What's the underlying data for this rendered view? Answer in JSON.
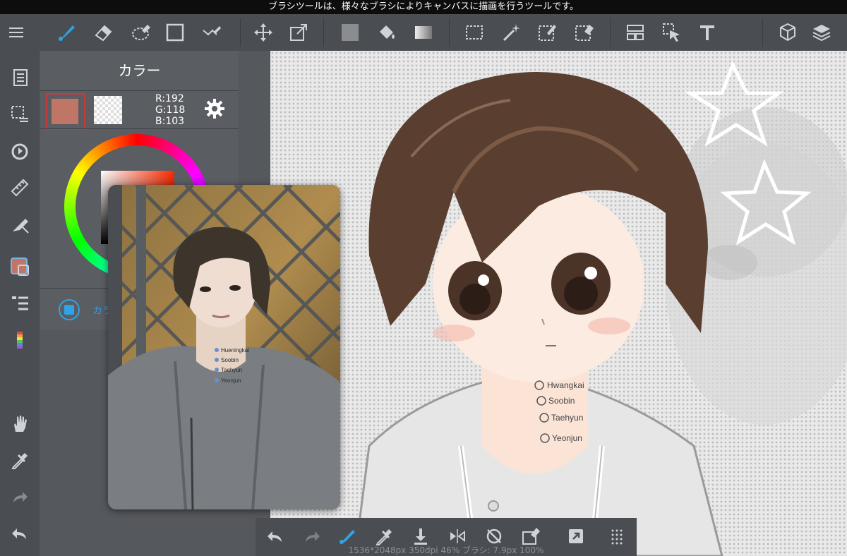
{
  "status_bar": {
    "hint": "ブラシツールは、様々なブラシによりキャンバスに描画を行うツールです。"
  },
  "toolbar": {
    "icons": [
      "menu-icon",
      "brush-icon",
      "eraser-icon",
      "blur-icon",
      "rectangle-icon",
      "select-icon",
      "move-icon",
      "transform-icon",
      "fill-color-icon",
      "bucket-icon",
      "gradient-icon",
      "select-rect-icon",
      "magic-wand-icon",
      "select-pen-icon",
      "select-eraser-icon",
      "frame-icon",
      "operation-icon",
      "text-icon",
      "3d-icon",
      "layers-icon"
    ]
  },
  "color_panel": {
    "title": "カラー",
    "r": "R:192",
    "g": "G:118",
    "b": "B:103",
    "primary_color": "#c07667",
    "secondary_color": "transparent",
    "mode_label": "カラ"
  },
  "bottom_bar": {
    "status_text": "1536*2048px 350dpi 46% ブラシ: 7.9px 100%"
  },
  "artwork": {
    "names": [
      "Hwangkai",
      "Soobin",
      "Taehyun",
      "Yeonjun"
    ]
  },
  "photo_overlay": {
    "names": [
      "Hueningkai",
      "Soobin",
      "Taehyun",
      "Yeonjun"
    ]
  }
}
